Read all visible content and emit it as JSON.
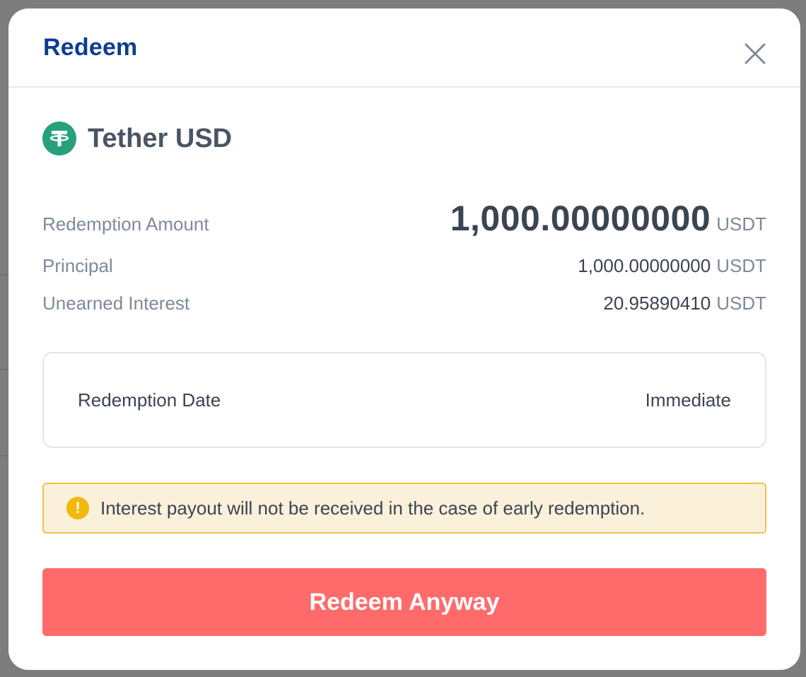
{
  "modal": {
    "title": "Redeem"
  },
  "asset": {
    "name": "Tether USD",
    "icon": "tether-icon",
    "icon_color": "#26a17b"
  },
  "summary": {
    "redemption_amount": {
      "label": "Redemption Amount",
      "value": "1,000.00000000",
      "unit": "USDT"
    },
    "principal": {
      "label": "Principal",
      "value": "1,000.00000000",
      "unit": "USDT"
    },
    "unearned_interest": {
      "label": "Unearned Interest",
      "value": "20.95890410",
      "unit": "USDT"
    }
  },
  "redemption_date": {
    "label": "Redemption Date",
    "value": "Immediate"
  },
  "warning": {
    "icon": "exclamation-icon",
    "text": "Interest payout will not be received in the case of early redemption."
  },
  "cta": {
    "label": "Redeem Anyway",
    "color": "#ff6b6b"
  },
  "colors": {
    "title": "#0b3d91",
    "warning_bg": "#fbf0da",
    "warning_border": "#f0c14b"
  }
}
